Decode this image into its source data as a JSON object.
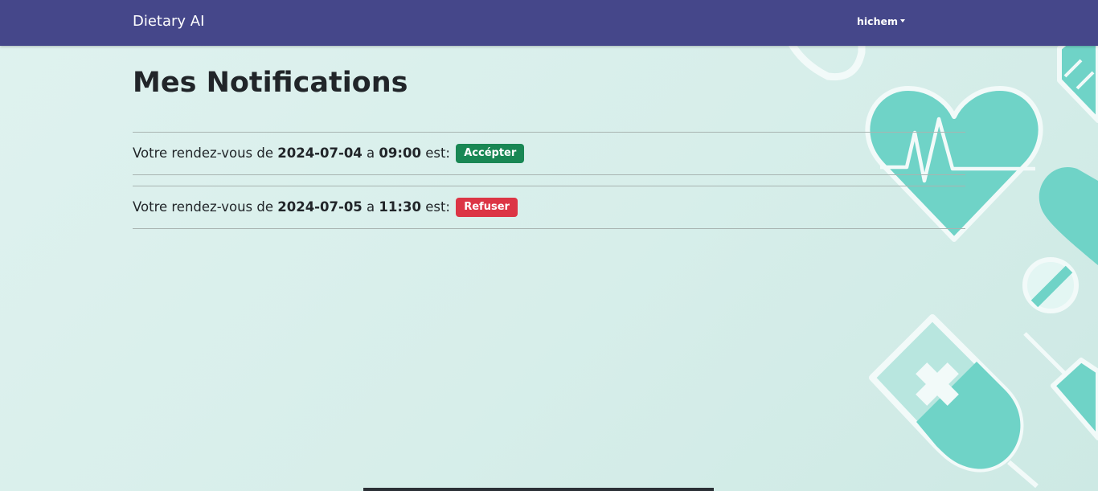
{
  "navbar": {
    "brand": "Dietary AI",
    "user": "hichem"
  },
  "page": {
    "title": "Mes Notifications"
  },
  "notifications": [
    {
      "prefix": "Votre rendez-vous de",
      "date": "2024-07-04",
      "connector": "a",
      "time": "09:00",
      "suffix": "est:",
      "status": "Accépter",
      "status_color": "#198754"
    },
    {
      "prefix": "Votre rendez-vous de",
      "date": "2024-07-05",
      "connector": "a",
      "time": "11:30",
      "suffix": "est:",
      "status": "Refuser",
      "status_color": "#dc3545"
    }
  ],
  "colors": {
    "navbar": "#45478a",
    "background": "#dff2ef",
    "decor_accent": "#6fd3c7",
    "decor_outline": "#f2faf9"
  },
  "decor_icons": [
    "heartbeat-icon",
    "syringe-icon",
    "pill-icon",
    "medicine-bag-icon"
  ]
}
